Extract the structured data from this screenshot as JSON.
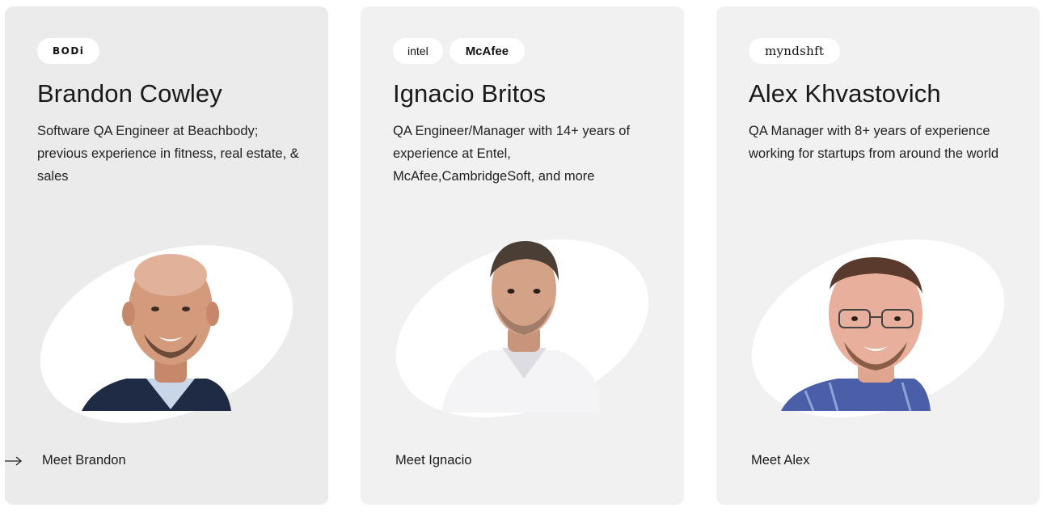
{
  "cards": [
    {
      "logos": [
        "BODi"
      ],
      "name": "Brandon Cowley",
      "bio": "Software QA Engineer at Beachbody; previous experience in fitness, real estate, & sales",
      "link": "Meet Brandon",
      "shirt_color": "#1f2a44"
    },
    {
      "logos": [
        "intel",
        "McAfee"
      ],
      "name": "Ignacio Britos",
      "bio": "QA Engineer/Manager with 14+ years of experience at Entel, McAfee,CambridgeSoft, and more",
      "link": "Meet Ignacio",
      "shirt_color": "#f4f4f6"
    },
    {
      "logos": [
        "myndshft"
      ],
      "name": "Alex Khvastovich",
      "bio": "QA Manager with 8+ years of experience working for startups from around the world",
      "link": "Meet Alex",
      "shirt_color": "#4a5fa8"
    }
  ],
  "colors": {
    "card_active": "#ebebeb",
    "card": "#f1f1f1",
    "text": "#1a1a1a"
  },
  "icons": {
    "link_arrow": "arrow-right-icon"
  }
}
